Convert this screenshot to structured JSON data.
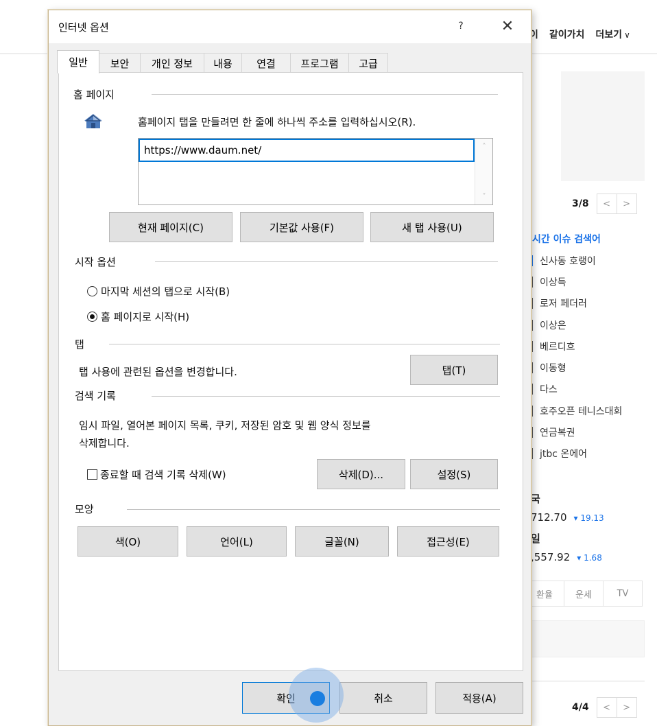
{
  "background_page": {
    "nav": [
      "이",
      "같이가치",
      "더보기"
    ],
    "nav_chevron": "∨",
    "slide_pager": "3/8",
    "news_pager": "4/4",
    "pager_prev": "<",
    "pager_next": ">",
    "realtime_title": "시간 이슈 검색어",
    "realtime_items": [
      "신사동 호랭이",
      "이상득",
      "로저 페더러",
      "이상은",
      "베르디흐",
      "이동형",
      "다스",
      "호주오픈 테니스대회",
      "연금복권",
      "jtbc 온에어"
    ],
    "stocks": [
      {
        "label": "국",
        "value": "712.70",
        "change": "▾ 19.13"
      },
      {
        "label": "일",
        "value": ",557.92",
        "change": "▾ 1.68"
      }
    ],
    "bottom_tabs": [
      "환율",
      "운세",
      "TV"
    ]
  },
  "dialog": {
    "title": "인터넷 옵션",
    "help_label": "?",
    "close_label": "✕",
    "tabs": [
      {
        "label": "일반",
        "active": true
      },
      {
        "label": "보안",
        "active": false
      },
      {
        "label": "개인 정보",
        "active": false
      },
      {
        "label": "내용",
        "active": false
      },
      {
        "label": "연결",
        "active": false
      },
      {
        "label": "프로그램",
        "active": false
      },
      {
        "label": "고급",
        "active": false
      }
    ],
    "home_page": {
      "heading": "홈 페이지",
      "description": "홈페이지 탭을 만들려면 한 줄에 하나씩 주소를 입력하십시오(R).",
      "url": "https://www.daum.net/",
      "scroll_up": "˄",
      "scroll_down": "˅",
      "buttons": [
        "현재 페이지(C)",
        "기본값 사용(F)",
        "새 탭 사용(U)"
      ]
    },
    "startup": {
      "heading": "시작 옵션",
      "options": [
        {
          "label": "마지막 세션의 탭으로 시작(B)",
          "selected": false
        },
        {
          "label": "홈 페이지로 시작(H)",
          "selected": true
        }
      ]
    },
    "tabs_section": {
      "heading": "탭",
      "description": "탭 사용에 관련된 옵션을 변경합니다.",
      "button": "탭(T)"
    },
    "history": {
      "heading": "검색 기록",
      "description_line1": "임시 파일, 열어본 페이지 목록, 쿠키, 저장된 암호 및 웹 양식 정보를",
      "description_line2": "삭제합니다.",
      "checkbox_label": "종료할 때 검색 기록 삭제(W)",
      "checkbox_checked": false,
      "delete_button": "삭제(D)...",
      "settings_button": "설정(S)"
    },
    "appearance": {
      "heading": "모양",
      "buttons": [
        "색(O)",
        "언어(L)",
        "글꼴(N)",
        "접근성(E)"
      ]
    },
    "footer": {
      "ok": "확인",
      "cancel": "취소",
      "apply": "적용(A)"
    }
  }
}
